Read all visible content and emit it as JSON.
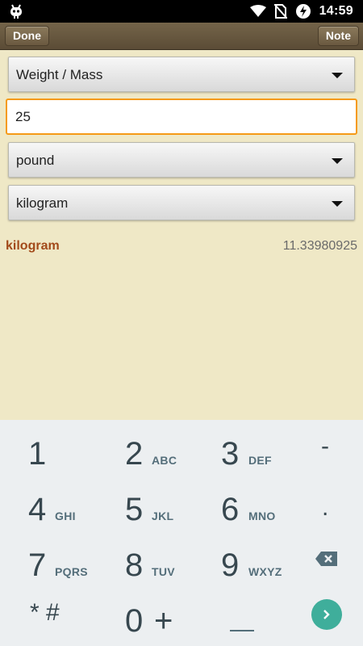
{
  "status_bar": {
    "time": "14:59",
    "icons": [
      "android-robot-icon",
      "wifi-icon",
      "no-sim-icon",
      "sync-icon",
      "battery-icon"
    ]
  },
  "toolbar": {
    "done_label": "Done",
    "note_label": "Note"
  },
  "converter": {
    "category": "Weight / Mass",
    "input_value": "25",
    "from_unit": "pound",
    "to_unit": "kilogram"
  },
  "result": {
    "unit": "kilogram",
    "value": "11.33980925"
  },
  "keypad": {
    "keys": [
      {
        "digit": "1",
        "letters": ""
      },
      {
        "digit": "2",
        "letters": "ABC"
      },
      {
        "digit": "3",
        "letters": "DEF"
      },
      {
        "digit": "4",
        "letters": "GHI"
      },
      {
        "digit": "5",
        "letters": "JKL"
      },
      {
        "digit": "6",
        "letters": "MNO"
      },
      {
        "digit": "7",
        "letters": "PQRS"
      },
      {
        "digit": "8",
        "letters": "TUV"
      },
      {
        "digit": "9",
        "letters": "WXYZ"
      },
      {
        "digit": "0",
        "letters": "+"
      }
    ],
    "star_hash": "* #",
    "minus": "-",
    "dot": ".",
    "backspace_icon": "backspace-icon",
    "go_icon": "chevron-right-icon"
  },
  "colors": {
    "background": "#efe8c6",
    "accent": "#f59a16",
    "result_unit": "#a24a1a",
    "go": "#3fae9b"
  }
}
